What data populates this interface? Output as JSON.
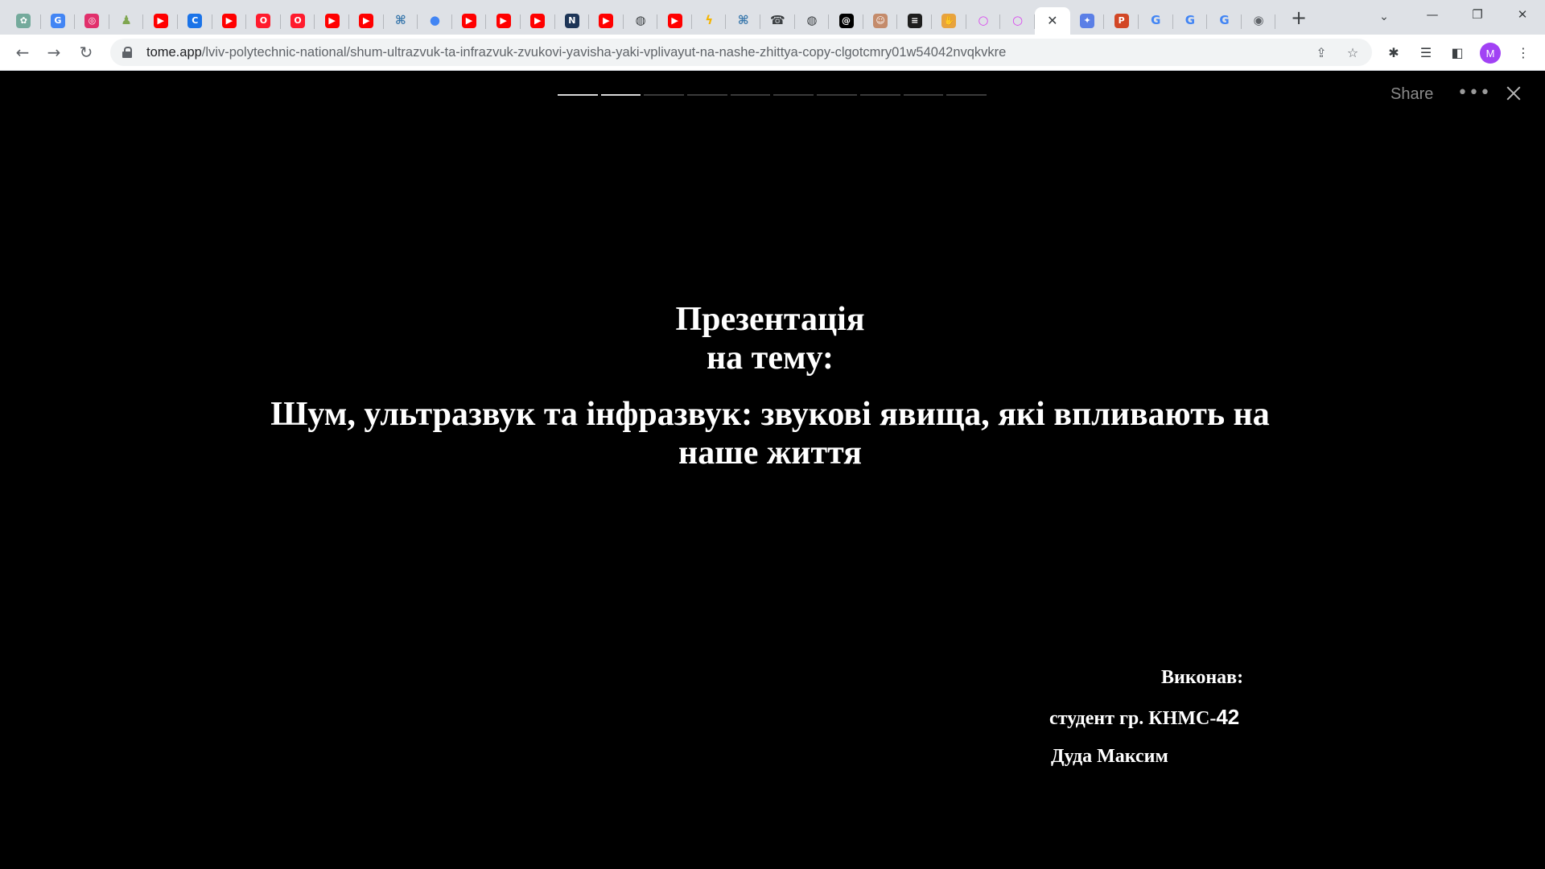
{
  "browser": {
    "tabs": [
      {
        "icon": "chatgpt-icon",
        "color": "#74aa9c"
      },
      {
        "icon": "translate-icon",
        "color": "#4285f4"
      },
      {
        "icon": "instagram-icon",
        "color": "#e1306c"
      },
      {
        "icon": "chess-icon",
        "color": "#7fa650"
      },
      {
        "icon": "youtube-icon",
        "color": "#ff0000"
      },
      {
        "icon": "c-app-icon",
        "color": "#1a73e8"
      },
      {
        "icon": "youtube-icon",
        "color": "#ff0000"
      },
      {
        "icon": "opera-icon",
        "color": "#ff1b2d"
      },
      {
        "icon": "opera-icon",
        "color": "#ff1b2d"
      },
      {
        "icon": "youtube-icon",
        "color": "#ff0000"
      },
      {
        "icon": "youtube-icon",
        "color": "#ff0000"
      },
      {
        "icon": "python-icon",
        "color": "#3776ab"
      },
      {
        "icon": "pin-icon",
        "color": "#4285f4"
      },
      {
        "icon": "youtube-icon",
        "color": "#ff0000"
      },
      {
        "icon": "youtube-icon",
        "color": "#ff0000"
      },
      {
        "icon": "youtube-icon",
        "color": "#ff0000"
      },
      {
        "icon": "nodes-icon",
        "color": "#1d3557"
      },
      {
        "icon": "youtube-icon",
        "color": "#ff0000"
      },
      {
        "icon": "globe-icon",
        "color": "#3c4043"
      },
      {
        "icon": "youtube-icon",
        "color": "#ff0000"
      },
      {
        "icon": "lightning-icon",
        "color": "#f4b400"
      },
      {
        "icon": "python-icon",
        "color": "#3776ab"
      },
      {
        "icon": "phone-icon",
        "color": "#3c4043"
      },
      {
        "icon": "globe-icon",
        "color": "#3c4043"
      },
      {
        "icon": "threads-icon",
        "color": "#000000"
      },
      {
        "icon": "avatar-tab-icon",
        "color": "#c48b6b"
      },
      {
        "icon": "terminal-icon",
        "color": "#1e1e1e"
      },
      {
        "icon": "hand-icon",
        "color": "#e8a33d"
      },
      {
        "icon": "ring-icon",
        "color": "#d946ef"
      },
      {
        "icon": "ring-icon",
        "color": "#d946ef"
      },
      {
        "icon": "close-icon",
        "color": "#3c4043",
        "active": true
      },
      {
        "icon": "copilot-icon",
        "color": "#5b7fe6"
      },
      {
        "icon": "powerpoint-icon",
        "color": "#d24726"
      },
      {
        "icon": "google-icon",
        "color": "#4285f4"
      },
      {
        "icon": "google-icon",
        "color": "#4285f4"
      },
      {
        "icon": "google-icon",
        "color": "#4285f4"
      },
      {
        "icon": "chrome-icon",
        "color": "#5f6368"
      }
    ],
    "url_host": "tome.app",
    "url_path": "/lviv-polytechnic-national/shum-ultrazvuk-ta-infrazvuk-zvukovi-yavisha-yaki-vplivayut-na-nashe-zhittya-copy-clgotcmry01w54042nvqkvkre",
    "profile_initial": "M",
    "profile_color": "#a142f4"
  },
  "viewer": {
    "progress": {
      "total": 10,
      "current": 2
    },
    "share_label": "Share",
    "more_label": "•••"
  },
  "slide": {
    "heading_line1": "Презентація",
    "heading_line2": "на тему:",
    "title": "Шум, ультразвук та інфразвук: звукові явища, які впливають на наше життя",
    "author_label": "Виконав:",
    "author_group_text": "студент гр. КНМС-",
    "author_group_num": "42",
    "author_name": "Дуда Максим"
  }
}
